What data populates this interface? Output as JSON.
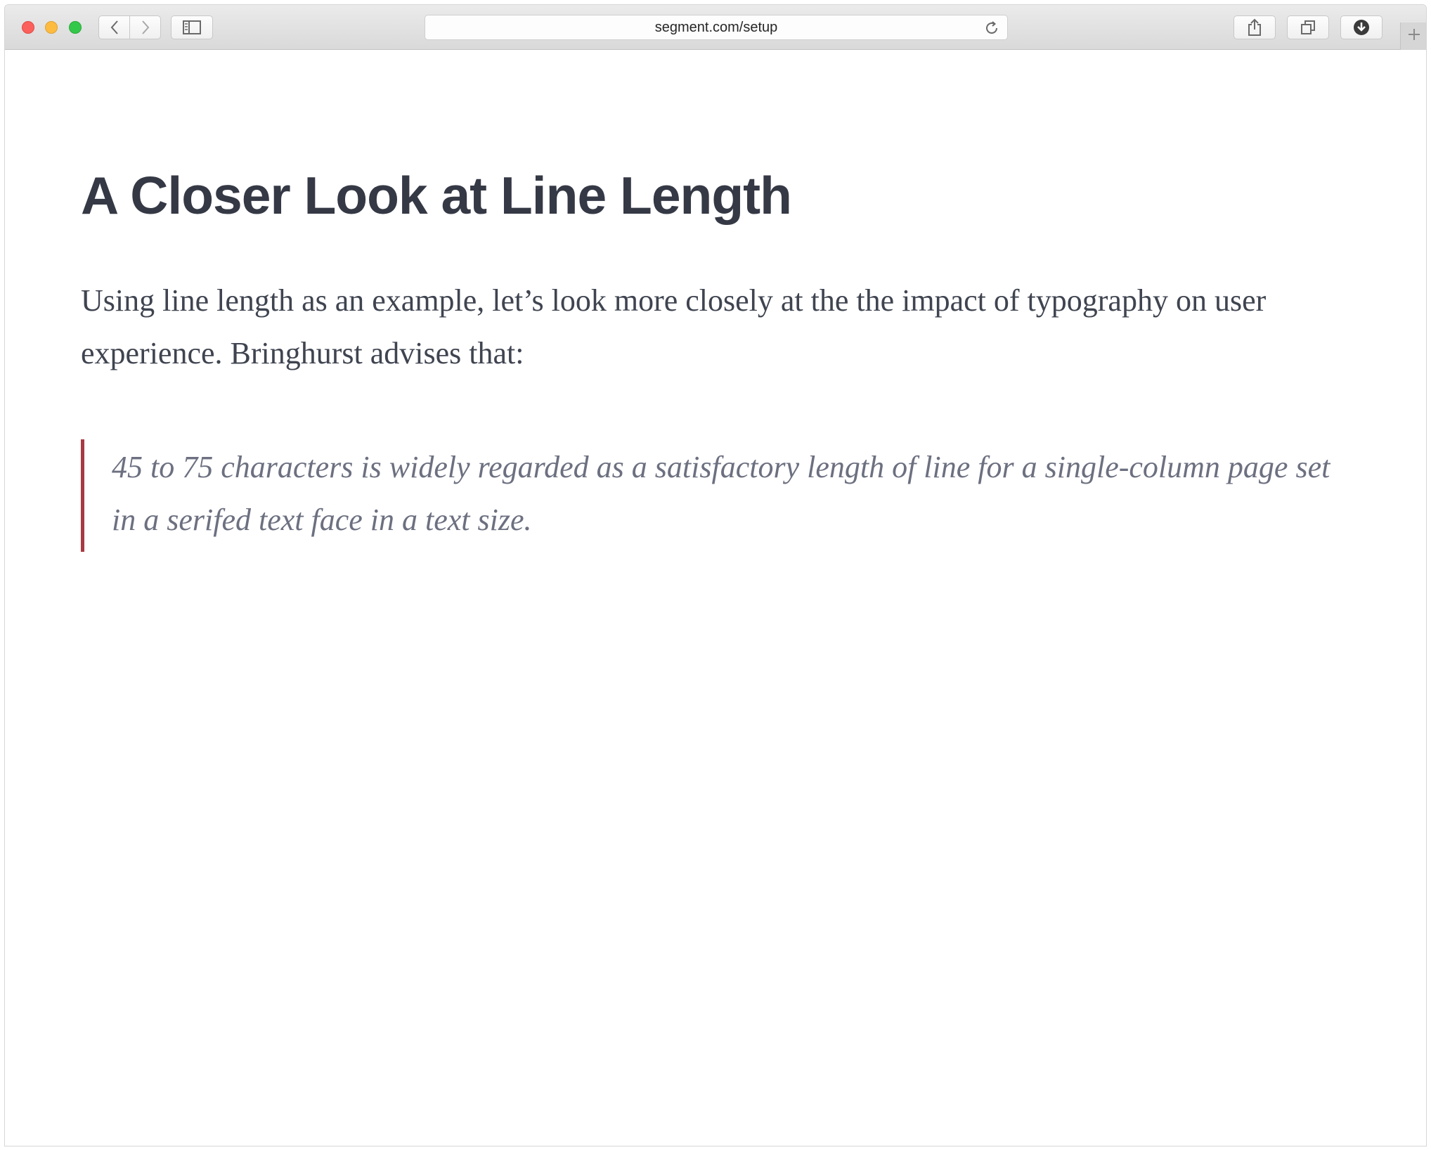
{
  "browser": {
    "url": "segment.com/setup",
    "icons": {
      "close": "close-window-icon",
      "minimize": "minimize-window-icon",
      "maximize": "maximize-window-icon",
      "back": "chevron-left-icon",
      "forward": "chevron-right-icon",
      "sidebar": "sidebar-icon",
      "reload": "reload-icon",
      "share": "share-icon",
      "tabs": "tabs-icon",
      "download": "download-icon",
      "new_tab": "plus-icon"
    }
  },
  "article": {
    "title": "A Closer Look at Line Length",
    "intro": "Using line length as an example, let’s look more closely at the the impact of typography on user experience. Bringhurst advises that:",
    "quote": "45 to 75 characters is widely regarded as a satisfactory length of line for a single-column page set in a serifed text face in a text size."
  },
  "colors": {
    "heading": "#353945",
    "body_text": "#3f4450",
    "quote_text": "#6c7080",
    "quote_border": "#a83a43"
  }
}
